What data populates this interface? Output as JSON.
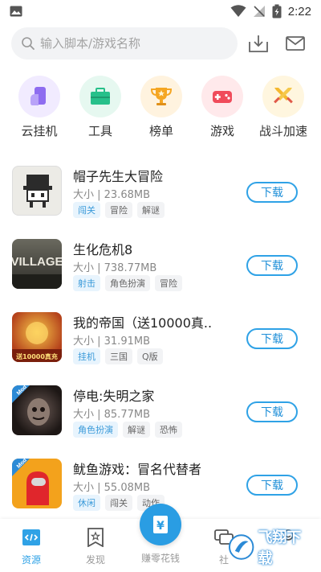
{
  "status_bar": {
    "time": "2:22"
  },
  "search": {
    "placeholder": "输入脚本/游戏名称"
  },
  "categories": [
    {
      "label": "云挂机",
      "icon": "cloud-phone-icon",
      "color": "#8e6cf0"
    },
    {
      "label": "工具",
      "icon": "toolbox-icon",
      "color": "#27c08a"
    },
    {
      "label": "榜单",
      "icon": "trophy-icon",
      "color": "#f5a623"
    },
    {
      "label": "游戏",
      "icon": "gamepad-icon",
      "color": "#f04b5b"
    },
    {
      "label": "战斗加速",
      "icon": "swords-icon",
      "color": "#f5b82e"
    }
  ],
  "games": [
    {
      "title": "帽子先生大冒险",
      "size": "大小 | 23.68MB",
      "tags": [
        "闯关",
        "冒险",
        "解谜"
      ],
      "download": "下载"
    },
    {
      "title": "生化危机8",
      "size": "大小 | 738.77MB",
      "tags": [
        "射击",
        "角色扮演",
        "冒险"
      ],
      "download": "下载",
      "thumb_text": "VILLAGE"
    },
    {
      "title": "我的帝国（送10000真..",
      "size": "大小 | 31.91MB",
      "tags": [
        "挂机",
        "三国",
        "Q版"
      ],
      "download": "下载",
      "thumb_text": "送10000真充"
    },
    {
      "title": "停电:失明之家",
      "size": "大小 | 85.77MB",
      "tags": [
        "角色扮演",
        "解谜",
        "恐怖"
      ],
      "download": "下载",
      "badge": "Mod"
    },
    {
      "title": "鱿鱼游戏：冒名代替者",
      "size": "大小 | 55.08MB",
      "tags": [
        "休闲",
        "闯关",
        "动作"
      ],
      "download": "下载",
      "badge": "Mod"
    }
  ],
  "tabbar": {
    "items": [
      {
        "label": "资源",
        "icon": "resource-icon"
      },
      {
        "label": "发现",
        "icon": "discover-icon"
      },
      {
        "label": "赚零花钱",
        "icon": "money-icon"
      },
      {
        "label": "社",
        "icon": "community-icon"
      },
      {
        "label": "",
        "icon": "profile-icon"
      }
    ],
    "active_color": "#2fa2e6"
  },
  "watermark": {
    "text": "飞翔下载"
  }
}
